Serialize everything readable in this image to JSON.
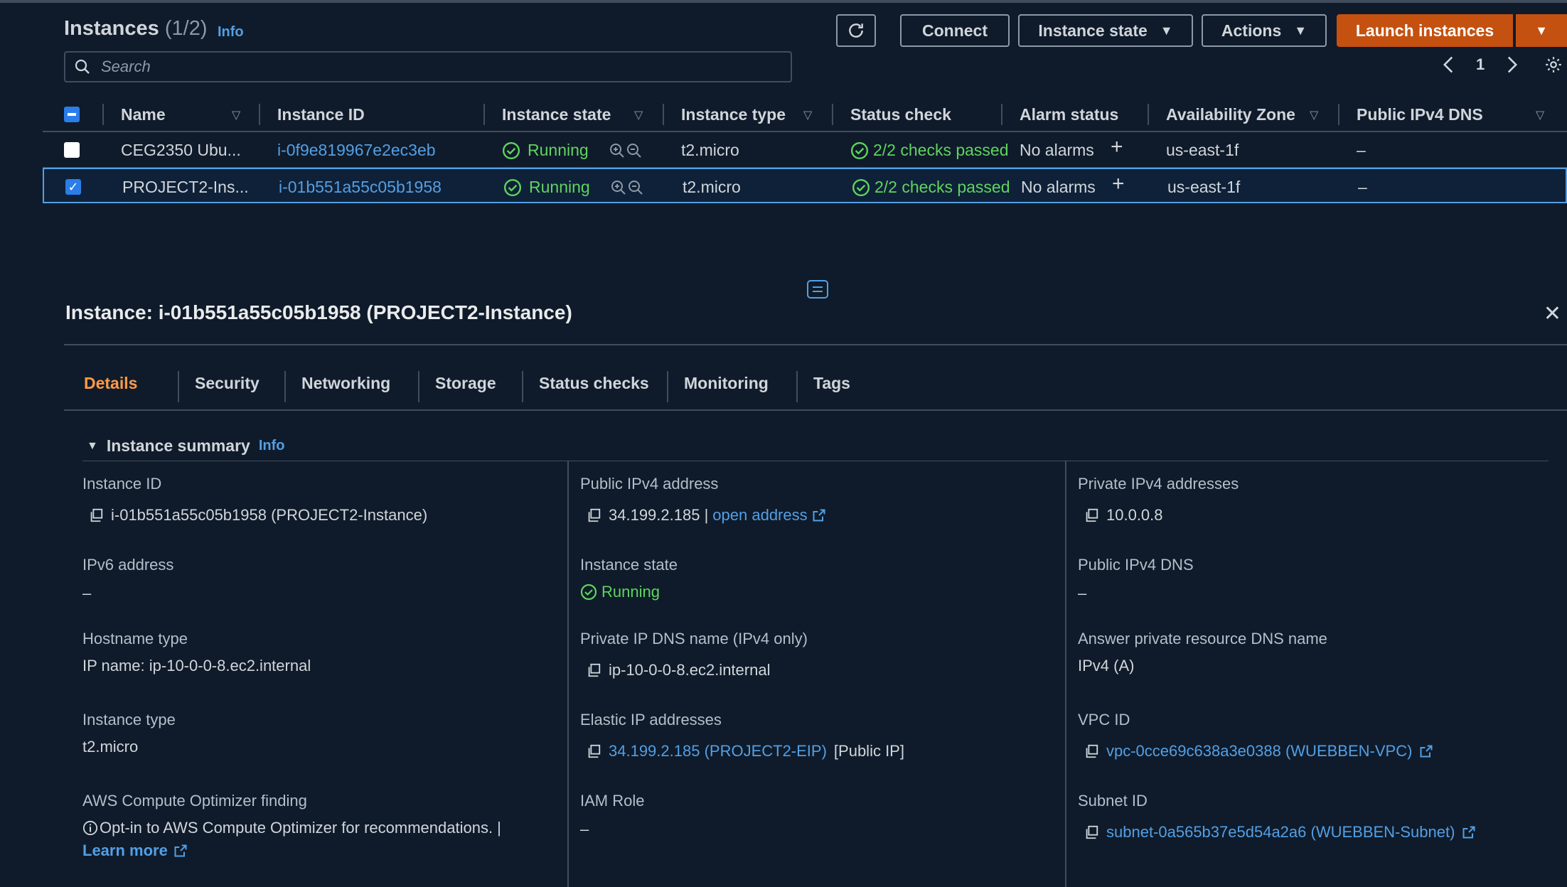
{
  "header": {
    "title": "Instances",
    "count": "(1/2)",
    "info": "Info",
    "connect": "Connect",
    "instance_state": "Instance state",
    "actions": "Actions",
    "launch": "Launch instances",
    "search_placeholder": "Search",
    "page": "1"
  },
  "table": {
    "columns": [
      "Name",
      "Instance ID",
      "Instance state",
      "Instance type",
      "Status check",
      "Alarm status",
      "Availability Zone",
      "Public IPv4 DNS"
    ],
    "rows": [
      {
        "name": "CEG2350 Ubu...",
        "id": "i-0f9e819967e2ec3eb",
        "state": "Running",
        "type": "t2.micro",
        "status": "2/2 checks passed",
        "alarm": "No alarms",
        "az": "us-east-1f",
        "dns": "–",
        "selected": false
      },
      {
        "name": "PROJECT2-Ins...",
        "id": "i-01b551a55c05b1958",
        "state": "Running",
        "type": "t2.micro",
        "status": "2/2 checks passed",
        "alarm": "No alarms",
        "az": "us-east-1f",
        "dns": "–",
        "selected": true
      }
    ]
  },
  "detail": {
    "title": "Instance: i-01b551a55c05b1958 (PROJECT2-Instance)",
    "tabs": [
      "Details",
      "Security",
      "Networking",
      "Storage",
      "Status checks",
      "Monitoring",
      "Tags"
    ],
    "summary_title": "Instance summary",
    "summary_info": "Info",
    "col1": {
      "instance_id_label": "Instance ID",
      "instance_id": "i-01b551a55c05b1958 (PROJECT2-Instance)",
      "ipv6_label": "IPv6 address",
      "ipv6": "–",
      "hostname_label": "Hostname type",
      "hostname": "IP name: ip-10-0-0-8.ec2.internal",
      "type_label": "Instance type",
      "type": "t2.micro",
      "optimizer_label": "AWS Compute Optimizer finding",
      "optimizer_text": "Opt-in to AWS Compute Optimizer for recommendations. |",
      "learn_more": "Learn more"
    },
    "col2": {
      "public_ip_label": "Public IPv4 address",
      "public_ip": "34.199.2.185 |",
      "open_address": "open address",
      "state_label": "Instance state",
      "state": "Running",
      "private_dns_label": "Private IP DNS name (IPv4 only)",
      "private_dns": "ip-10-0-0-8.ec2.internal",
      "eip_label": "Elastic IP addresses",
      "eip": "34.199.2.185 (PROJECT2-EIP)",
      "eip_suffix": "[Public IP]",
      "iam_label": "IAM Role",
      "iam": "–"
    },
    "col3": {
      "private_ip_label": "Private IPv4 addresses",
      "private_ip": "10.0.0.8",
      "public_dns_label": "Public IPv4 DNS",
      "public_dns": "–",
      "answer_label": "Answer private resource DNS name",
      "answer": "IPv4 (A)",
      "vpc_label": "VPC ID",
      "vpc": "vpc-0cce69c638a3e0388 (WUEBBEN-VPC)",
      "subnet_label": "Subnet ID",
      "subnet": "subnet-0a565b37e5d54a2a6 (WUEBBEN-Subnet)"
    }
  },
  "colors": {
    "background": "#0f1b2a",
    "link": "#539fe5",
    "primary": "#c45110",
    "running": "#29ad32",
    "active_tab": "#ff9b47"
  }
}
